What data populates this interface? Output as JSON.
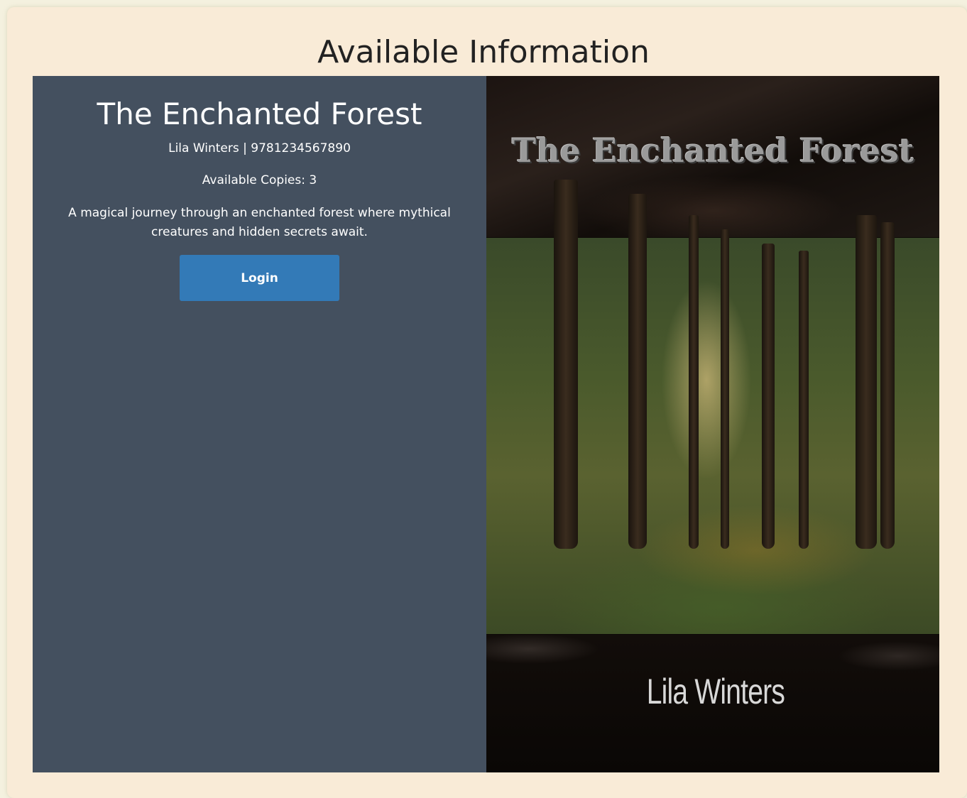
{
  "page": {
    "title": "Available Information"
  },
  "book": {
    "title": "The Enchanted Forest",
    "meta": "Lila Winters | 9781234567890",
    "copies": "Available Copies: 3",
    "description": "A magical journey through an enchanted forest where mythical creatures and hidden secrets await.",
    "login_label": "Login"
  },
  "cover": {
    "title": "The Enchanted Forest",
    "author": "Lila Winters"
  },
  "colors": {
    "page_background": "#f9ebd7",
    "info_panel": "#44505f",
    "button": "#337ab7"
  }
}
